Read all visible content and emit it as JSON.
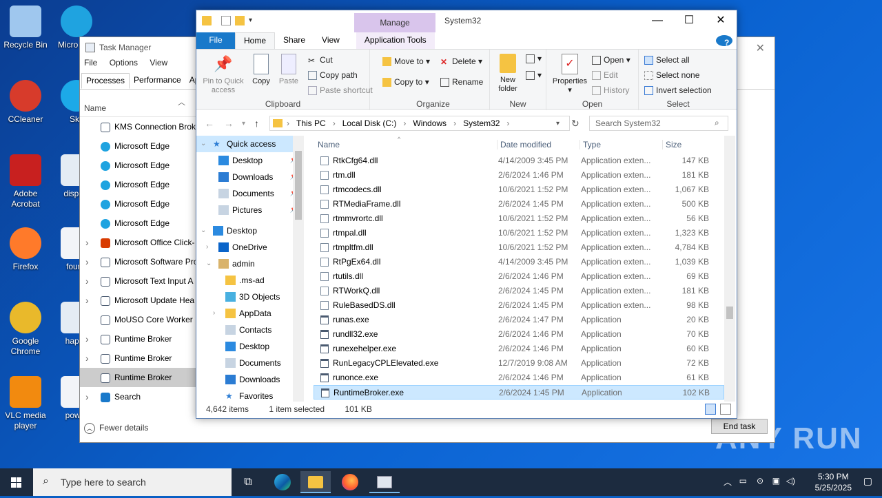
{
  "desktop": {
    "icons": [
      {
        "label": "Recycle Bin",
        "icon": "recycle-bin-icon"
      },
      {
        "label": "Micro Edg",
        "icon": "edge-icon"
      },
      {
        "label": "CCleaner",
        "icon": "ccleaner-icon"
      },
      {
        "label": "Sky",
        "icon": "skype-icon"
      },
      {
        "label": "Adobe Acrobat",
        "icon": "acrobat-icon"
      },
      {
        "label": "display",
        "icon": "image-file-icon"
      },
      {
        "label": "Firefox",
        "icon": "firefox-icon"
      },
      {
        "label": "found",
        "icon": "word-doc-icon"
      },
      {
        "label": "Google Chrome",
        "icon": "chrome-icon"
      },
      {
        "label": "happy",
        "icon": "image-file-icon"
      },
      {
        "label": "VLC media player",
        "icon": "vlc-icon"
      },
      {
        "label": "power",
        "icon": "word-doc-icon"
      }
    ],
    "watermark": "ANY RUN"
  },
  "task_manager": {
    "title": "Task Manager",
    "menu": [
      "File",
      "Options",
      "View"
    ],
    "tabs": [
      "Processes",
      "Performance",
      "Ap"
    ],
    "column_name": "Name",
    "processes": [
      {
        "name": "KMS Connection Brok",
        "expand": false,
        "icon": "app-window-icon"
      },
      {
        "name": "Microsoft Edge",
        "expand": false,
        "icon": "edge-icon"
      },
      {
        "name": "Microsoft Edge",
        "expand": false,
        "icon": "edge-icon"
      },
      {
        "name": "Microsoft Edge",
        "expand": false,
        "icon": "edge-icon"
      },
      {
        "name": "Microsoft Edge",
        "expand": false,
        "icon": "edge-icon"
      },
      {
        "name": "Microsoft Edge",
        "expand": false,
        "icon": "edge-icon"
      },
      {
        "name": "Microsoft Office Click-",
        "expand": true,
        "icon": "office-icon"
      },
      {
        "name": "Microsoft Software Pro",
        "expand": true,
        "icon": "app-window-icon"
      },
      {
        "name": "Microsoft Text Input A",
        "expand": true,
        "icon": "app-window-icon"
      },
      {
        "name": "Microsoft Update Hea",
        "expand": true,
        "icon": "app-window-icon"
      },
      {
        "name": "MoUSO Core Worker P",
        "expand": false,
        "icon": "app-window-icon"
      },
      {
        "name": "Runtime Broker",
        "expand": true,
        "icon": "app-window-icon"
      },
      {
        "name": "Runtime Broker",
        "expand": true,
        "icon": "app-window-icon"
      },
      {
        "name": "Runtime Broker",
        "expand": false,
        "icon": "app-window-icon",
        "selected": true
      },
      {
        "name": "Search",
        "expand": true,
        "icon": "search-icon"
      }
    ],
    "fewer_details": "Fewer details",
    "end_task": "End task"
  },
  "explorer": {
    "title": "System32",
    "manage_tab": "Manage",
    "ribbon_tabs": [
      "File",
      "Home",
      "Share",
      "View",
      "Application Tools"
    ],
    "clipboard": {
      "pin": "Pin to Quick access",
      "copy": "Copy",
      "paste": "Paste",
      "cut": "Cut",
      "copy_path": "Copy path",
      "paste_shortcut": "Paste shortcut",
      "label": "Clipboard"
    },
    "organize": {
      "move_to": "Move to",
      "copy_to": "Copy to",
      "delete": "Delete",
      "rename": "Rename",
      "label": "Organize"
    },
    "new": {
      "new_folder": "New folder",
      "label": "New"
    },
    "open": {
      "properties": "Properties",
      "open": "Open",
      "edit": "Edit",
      "history": "History",
      "label": "Open"
    },
    "select": {
      "select_all": "Select all",
      "select_none": "Select none",
      "invert": "Invert selection",
      "label": "Select"
    },
    "breadcrumb": [
      "This PC",
      "Local Disk (C:)",
      "Windows",
      "System32"
    ],
    "search_placeholder": "Search System32",
    "nav": [
      {
        "label": "Quick access",
        "icon": "star-icon",
        "expand": "v",
        "qa": true
      },
      {
        "label": "Desktop",
        "icon": "desktop-folder-icon",
        "pin": true
      },
      {
        "label": "Downloads",
        "icon": "download-folder-icon",
        "pin": true
      },
      {
        "label": "Documents",
        "icon": "documents-folder-icon",
        "pin": true
      },
      {
        "label": "Pictures",
        "icon": "pictures-folder-icon",
        "pin": true
      },
      {
        "label": "Desktop",
        "icon": "desktop-folder-icon",
        "expand": "v",
        "root": true
      },
      {
        "label": "OneDrive",
        "icon": "onedrive-icon",
        "expand": ">"
      },
      {
        "label": "admin",
        "icon": "user-folder-icon",
        "expand": "v"
      },
      {
        "label": ".ms-ad",
        "icon": "folder-icon"
      },
      {
        "label": "3D Objects",
        "icon": "3d-objects-icon"
      },
      {
        "label": "AppData",
        "icon": "folder-icon",
        "expand": ">"
      },
      {
        "label": "Contacts",
        "icon": "contacts-icon"
      },
      {
        "label": "Desktop",
        "icon": "desktop-folder-icon"
      },
      {
        "label": "Documents",
        "icon": "documents-folder-icon"
      },
      {
        "label": "Downloads",
        "icon": "download-folder-icon"
      },
      {
        "label": "Favorites",
        "icon": "star-icon"
      }
    ],
    "columns": [
      "Name",
      "Date modified",
      "Type",
      "Size"
    ],
    "files": [
      {
        "name": "RtkCfg64.dll",
        "date": "4/14/2009 3:45 PM",
        "type": "Application exten...",
        "size": "147 KB"
      },
      {
        "name": "rtm.dll",
        "date": "2/6/2024 1:46 PM",
        "type": "Application exten...",
        "size": "181 KB"
      },
      {
        "name": "rtmcodecs.dll",
        "date": "10/6/2021 1:52 PM",
        "type": "Application exten...",
        "size": "1,067 KB"
      },
      {
        "name": "RTMediaFrame.dll",
        "date": "2/6/2024 1:45 PM",
        "type": "Application exten...",
        "size": "500 KB"
      },
      {
        "name": "rtmmvrortc.dll",
        "date": "10/6/2021 1:52 PM",
        "type": "Application exten...",
        "size": "56 KB"
      },
      {
        "name": "rtmpal.dll",
        "date": "10/6/2021 1:52 PM",
        "type": "Application exten...",
        "size": "1,323 KB"
      },
      {
        "name": "rtmpltfm.dll",
        "date": "10/6/2021 1:52 PM",
        "type": "Application exten...",
        "size": "4,784 KB"
      },
      {
        "name": "RtPgEx64.dll",
        "date": "4/14/2009 3:45 PM",
        "type": "Application exten...",
        "size": "1,039 KB"
      },
      {
        "name": "rtutils.dll",
        "date": "2/6/2024 1:46 PM",
        "type": "Application exten...",
        "size": "69 KB"
      },
      {
        "name": "RTWorkQ.dll",
        "date": "2/6/2024 1:45 PM",
        "type": "Application exten...",
        "size": "181 KB"
      },
      {
        "name": "RuleBasedDS.dll",
        "date": "2/6/2024 1:45 PM",
        "type": "Application exten...",
        "size": "98 KB"
      },
      {
        "name": "runas.exe",
        "date": "2/6/2024 1:47 PM",
        "type": "Application",
        "size": "20 KB"
      },
      {
        "name": "rundll32.exe",
        "date": "2/6/2024 1:46 PM",
        "type": "Application",
        "size": "70 KB"
      },
      {
        "name": "runexehelper.exe",
        "date": "2/6/2024 1:46 PM",
        "type": "Application",
        "size": "60 KB"
      },
      {
        "name": "RunLegacyCPLElevated.exe",
        "date": "12/7/2019 9:08 AM",
        "type": "Application",
        "size": "72 KB"
      },
      {
        "name": "runonce.exe",
        "date": "2/6/2024 1:46 PM",
        "type": "Application",
        "size": "61 KB"
      },
      {
        "name": "RuntimeBroker.exe",
        "date": "2/6/2024 1:45 PM",
        "type": "Application",
        "size": "102 KB",
        "selected": true
      }
    ],
    "status": {
      "items": "4,642 items",
      "selected": "1 item selected",
      "size": "101 KB"
    }
  },
  "taskbar": {
    "search_placeholder": "Type here to search",
    "time": "5:30 PM",
    "date": "5/25/2025",
    "apps": [
      "task-view-icon",
      "edge-icon",
      "file-explorer-icon",
      "firefox-icon",
      "task-manager-icon"
    ]
  },
  "colors": {
    "accent": "#1979ca",
    "selection": "#cce8ff",
    "manage": "#d9c5ec"
  }
}
